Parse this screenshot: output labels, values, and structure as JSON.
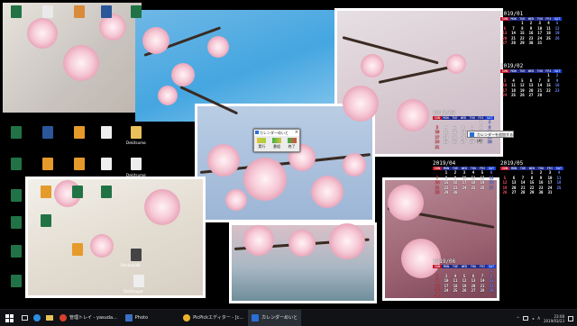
{
  "mini_window": {
    "title": "カレンダーめいと",
    "buttons": [
      {
        "label": "実行",
        "icon": "arrow-icon"
      },
      {
        "label": "番組",
        "icon": "book-icon"
      },
      {
        "label": "終了",
        "icon": "exit-icon"
      }
    ]
  },
  "popup": {
    "label": "カレンダーを追加する(A)"
  },
  "desktop_icons": {
    "row_labels": [
      "Dekitsumon",
      "DekitsumeLaw",
      "Dekitsumon",
      "DesktopWallpaper...",
      "Dekitsugami"
    ]
  },
  "calendars": [
    {
      "name": "2019/01",
      "dow": [
        "SUN",
        "MON",
        "TUE",
        "WED",
        "THU",
        "FRI",
        "SAT"
      ],
      "days": [
        "",
        "",
        "1",
        "2",
        "3",
        "4",
        "5",
        "6",
        "7",
        "8",
        "9",
        "10",
        "11",
        "12",
        "13",
        "14",
        "15",
        "16",
        "17",
        "18",
        "19",
        "20",
        "21",
        "22",
        "23",
        "24",
        "25",
        "26",
        "27",
        "28",
        "29",
        "30",
        "31",
        "",
        ""
      ]
    },
    {
      "name": "2019/02",
      "dow": [
        "SUN",
        "MON",
        "TUE",
        "WED",
        "THU",
        "FRI",
        "SAT"
      ],
      "days": [
        "",
        "",
        "",
        "",
        "",
        "1",
        "2",
        "3",
        "4",
        "5",
        "6",
        "7",
        "8",
        "9",
        "10",
        "11",
        "12",
        "13",
        "14",
        "15",
        "16",
        "17",
        "18",
        "19",
        "20",
        "21",
        "22",
        "23",
        "24",
        "25",
        "26",
        "27",
        "28",
        "",
        ""
      ]
    },
    {
      "name": "2019/03",
      "dow": [
        "SUN",
        "MON",
        "TUE",
        "WED",
        "THU",
        "FRI",
        "SAT"
      ],
      "days": [
        "",
        "",
        "",
        "",
        "",
        "1",
        "2",
        "3",
        "4",
        "5",
        "6",
        "7",
        "8",
        "9",
        "10",
        "11",
        "12",
        "13",
        "14",
        "15",
        "16",
        "17",
        "18",
        "19",
        "20",
        "21",
        "22",
        "23",
        "24",
        "25",
        "26",
        "27",
        "28",
        "29",
        "30",
        "31",
        "",
        "",
        "",
        "",
        "",
        ""
      ]
    },
    {
      "name": "2019/04",
      "dow": [
        "SUN",
        "MON",
        "TUE",
        "WED",
        "THU",
        "FRI",
        "SAT"
      ],
      "days": [
        "",
        "1",
        "2",
        "3",
        "4",
        "5",
        "6",
        "7",
        "8",
        "9",
        "10",
        "11",
        "12",
        "13",
        "14",
        "15",
        "16",
        "17",
        "18",
        "19",
        "20",
        "21",
        "22",
        "23",
        "24",
        "25",
        "26",
        "27",
        "28",
        "29",
        "30",
        "",
        "",
        "",
        ""
      ]
    },
    {
      "name": "2019/05",
      "dow": [
        "SUN",
        "MON",
        "TUE",
        "WED",
        "THU",
        "FRI",
        "SAT"
      ],
      "days": [
        "",
        "",
        "",
        "1",
        "2",
        "3",
        "4",
        "5",
        "6",
        "7",
        "8",
        "9",
        "10",
        "11",
        "12",
        "13",
        "14",
        "15",
        "16",
        "17",
        "18",
        "19",
        "20",
        "21",
        "22",
        "23",
        "24",
        "25",
        "26",
        "27",
        "28",
        "29",
        "30",
        "31",
        ""
      ]
    },
    {
      "name": "2019/06",
      "dow": [
        "SUN",
        "MON",
        "TUE",
        "WED",
        "THU",
        "FRI",
        "SAT"
      ],
      "days": [
        "",
        "",
        "",
        "",
        "",
        "",
        "1",
        "2",
        "3",
        "4",
        "5",
        "6",
        "7",
        "8",
        "9",
        "10",
        "11",
        "12",
        "13",
        "14",
        "15",
        "16",
        "17",
        "18",
        "19",
        "20",
        "21",
        "22",
        "23",
        "24",
        "25",
        "26",
        "27",
        "28",
        "29",
        "30"
      ]
    }
  ],
  "taskbar": {
    "apps": [
      {
        "label": "管理トレイ - yasuda...",
        "color": "#d8402c"
      },
      {
        "label": "Photo",
        "color": "#3a6fc2"
      },
      {
        "label": "PicPickエディター - [c...",
        "color": "#e9b42a"
      },
      {
        "label": "カレンダーめいと",
        "color": "#2a6fd6"
      }
    ],
    "time": "23:08",
    "date": "2019/03/23"
  }
}
